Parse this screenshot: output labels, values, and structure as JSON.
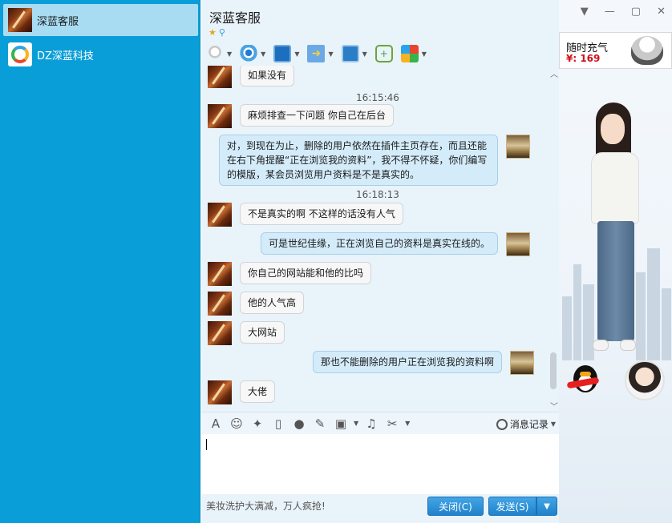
{
  "sidebar": {
    "contacts": [
      {
        "name": "深蓝客服",
        "active": true
      },
      {
        "name": "DZ深蓝科技",
        "active": false
      }
    ]
  },
  "chat": {
    "title": "深蓝客服",
    "title_icons": [
      "star-icon",
      "search-icon"
    ],
    "toolbar": [
      {
        "name": "microphone-icon",
        "dropdown": true
      },
      {
        "name": "camera-icon",
        "dropdown": true
      },
      {
        "name": "screen-share-icon",
        "dropdown": true
      },
      {
        "name": "file-transfer-icon",
        "dropdown": true
      },
      {
        "name": "remote-desktop-icon",
        "dropdown": true
      },
      {
        "name": "sms-icon",
        "dropdown": false
      },
      {
        "name": "apps-icon",
        "dropdown": true
      }
    ],
    "messages": [
      {
        "side": "left",
        "text": "如果没有"
      },
      {
        "type": "time",
        "text": "16:15:46"
      },
      {
        "side": "left",
        "text": "麻烦排查一下问题  你自己在后台"
      },
      {
        "side": "right",
        "text": "对，到现在为止，删除的用户依然在插件主页存在，而且还能在右下角提醒“正在浏览我的资料”，我不得不怀疑，你们编写的模版，某会员浏览用户资料是不是真实的。"
      },
      {
        "type": "time",
        "text": "16:18:13"
      },
      {
        "side": "left",
        "text": "不是真实的啊  不这样的话没有人气"
      },
      {
        "side": "right",
        "text": "可是世纪佳缘，正在浏览自己的资料是真实在线的。"
      },
      {
        "side": "left",
        "text": "你自己的网站能和他的比吗"
      },
      {
        "side": "left",
        "text": "他的人气高"
      },
      {
        "side": "left",
        "text": "大网站"
      },
      {
        "side": "right",
        "text": "那也不能删除的用户正在浏览我的资料啊"
      },
      {
        "side": "left",
        "text": "大佬"
      }
    ],
    "input_toolbar": {
      "history_label": "消息记录"
    },
    "ad_text": "美妆洗护大满减，万人疯抢!",
    "close_label": "关闭(C)",
    "send_label": "发送(S)"
  },
  "right_panel": {
    "promo_title": "随时充气",
    "promo_price": "¥: 169"
  },
  "colors": {
    "sidebar_bg": "#0a9ed8",
    "active_contact": "#a8dcf3",
    "button_blue": "#1f82cc",
    "price_red": "#d0111b"
  }
}
